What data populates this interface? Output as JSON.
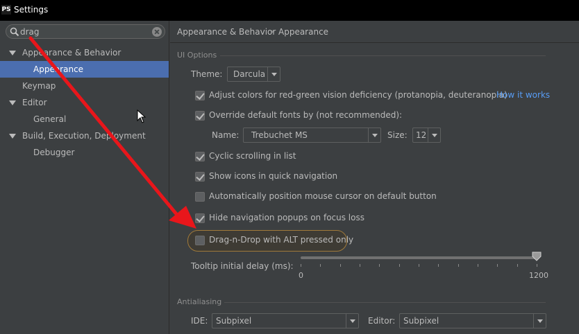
{
  "window": {
    "app_icon_text": "PS",
    "title": "Settings"
  },
  "search": {
    "value": "drag"
  },
  "tree": [
    {
      "label": "Appearance & Behavior",
      "expanded": true,
      "level": 0
    },
    {
      "label": "Appearance",
      "selected": true,
      "level": 1
    },
    {
      "label": "Keymap",
      "level": 0
    },
    {
      "label": "Editor",
      "expanded": true,
      "level": 0
    },
    {
      "label": "General",
      "level": 1
    },
    {
      "label": "Build, Execution, Deployment",
      "expanded": true,
      "level": 0
    },
    {
      "label": "Debugger",
      "level": 1
    }
  ],
  "breadcrumb": {
    "parent": "Appearance & Behavior",
    "separator": "›",
    "current": "Appearance"
  },
  "ui_options": {
    "title": "UI Options",
    "theme_label": "Theme:",
    "theme_value": "Darcula",
    "adjust_colors": {
      "label": "Adjust colors for red-green vision deficiency (protanopia, deuteranopia)",
      "checked": true,
      "link": "How it works"
    },
    "override_fonts": {
      "label": "Override default fonts by (not recommended):",
      "checked": true
    },
    "font_name_label": "Name:",
    "font_name_value": "Trebuchet MS",
    "font_size_label": "Size:",
    "font_size_value": "12",
    "cyclic_scrolling": {
      "label": "Cyclic scrolling in list",
      "checked": true
    },
    "show_icons": {
      "label": "Show icons in quick navigation",
      "checked": true
    },
    "auto_mouse": {
      "label": "Automatically position mouse cursor on default button",
      "checked": false
    },
    "hide_popups": {
      "label": "Hide navigation popups on focus loss",
      "checked": true
    },
    "drag_n_drop": {
      "label": "Drag-n-Drop with ALT pressed only",
      "checked": false
    },
    "tooltip_label": "Tooltip initial delay (ms):",
    "tooltip_min": "0",
    "tooltip_max": "1200",
    "tooltip_value_fraction": 1.0
  },
  "antialiasing": {
    "title": "Antialiasing",
    "ide_label": "IDE:",
    "ide_value": "Subpixel",
    "editor_label": "Editor:",
    "editor_value": "Subpixel"
  },
  "colors": {
    "selection": "#4b6eaf",
    "link": "#589df6",
    "annotation_arrow": "#e8161b",
    "highlight_border": "#a17a3a"
  }
}
